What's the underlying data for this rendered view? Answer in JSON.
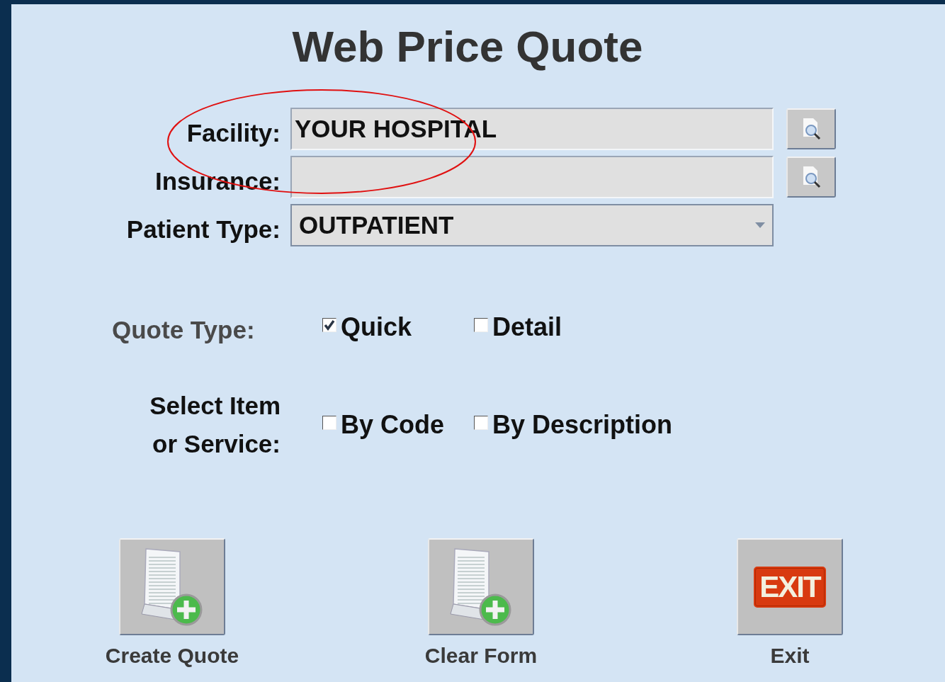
{
  "title": "Web Price Quote",
  "fields": [
    {
      "kind": "lookup",
      "label": "Facility:",
      "value": "YOUR HOSPITAL"
    },
    {
      "kind": "lookup",
      "label": "Insurance:"
    },
    {
      "kind": "select",
      "label": "Patient Type:",
      "value": "OUTPATIENT"
    }
  ],
  "quote_type": {
    "label": "Quote Type:",
    "options": [
      {
        "label": "Quick",
        "checked": true
      },
      {
        "label": "Detail",
        "checked": false
      }
    ]
  },
  "select_item": {
    "label": "Select Item\nor Service:",
    "options": [
      {
        "label": "By Code",
        "checked": false
      },
      {
        "label": "By Description",
        "checked": false
      }
    ]
  },
  "actions": [
    {
      "kind": "document",
      "label": "Create Quote"
    },
    {
      "kind": "document",
      "label": "Clear Form"
    },
    {
      "kind": "exit",
      "label": "Exit",
      "sign": "EXIT"
    }
  ],
  "annotations": [
    {
      "kind": "ellipse"
    }
  ]
}
